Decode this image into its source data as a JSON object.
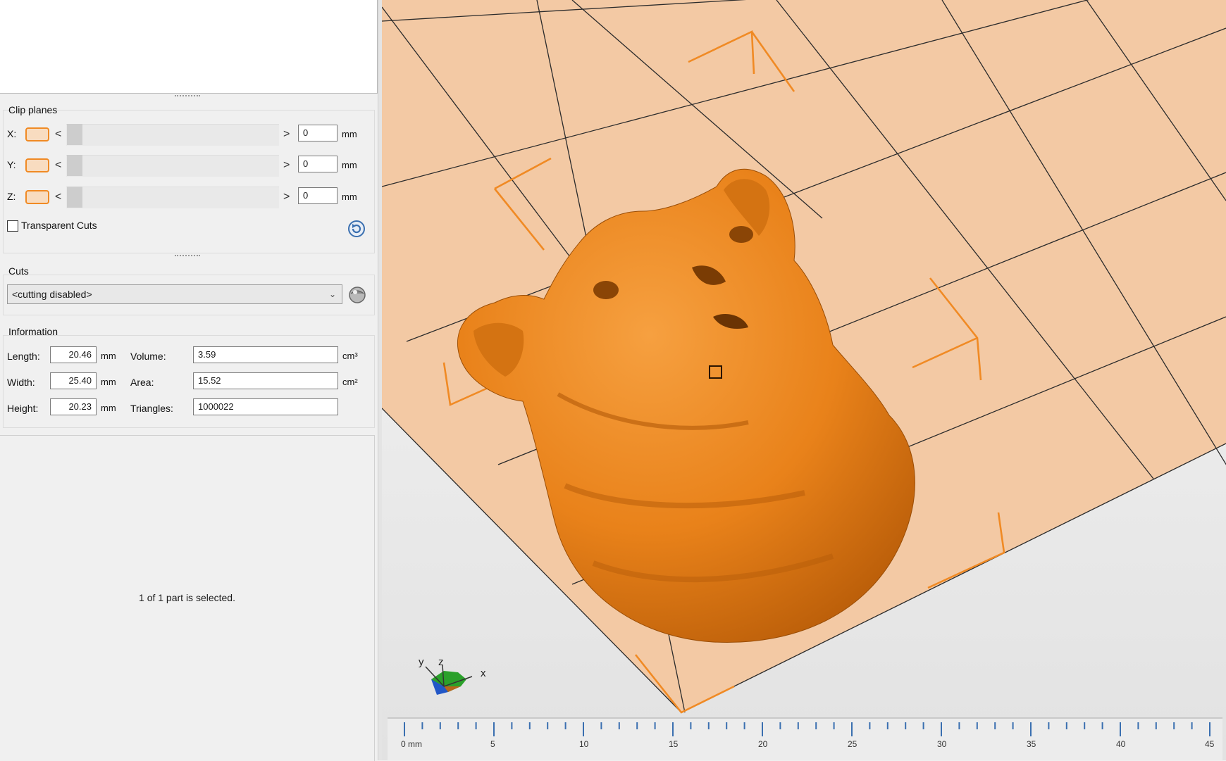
{
  "clip_planes": {
    "title": "Clip planes",
    "rows": [
      {
        "axis": "X:",
        "value": "0",
        "unit": "mm"
      },
      {
        "axis": "Y:",
        "value": "0",
        "unit": "mm"
      },
      {
        "axis": "Z:",
        "value": "0",
        "unit": "mm"
      }
    ],
    "transparent_cuts_label": "Transparent Cuts",
    "arrow_left": "<",
    "arrow_right": ">"
  },
  "cuts": {
    "title": "Cuts",
    "selected": "<cutting disabled>"
  },
  "information": {
    "title": "Information",
    "length_label": "Length:",
    "length": "20.46",
    "length_unit": "mm",
    "width_label": "Width:",
    "width": "25.40",
    "width_unit": "mm",
    "height_label": "Height:",
    "height": "20.23",
    "height_unit": "mm",
    "volume_label": "Volume:",
    "volume": "3.59",
    "volume_unit": "cm³",
    "area_label": "Area:",
    "area": "15.52",
    "area_unit": "cm²",
    "triangles_label": "Triangles:",
    "triangles": "1000022"
  },
  "status": {
    "selection": "1 of 1 part is selected."
  },
  "axis_triad": {
    "x": "x",
    "y": "y",
    "z": "z"
  },
  "ruler": {
    "ticks": [
      "0 mm",
      "5",
      "10",
      "15",
      "20",
      "25",
      "30",
      "35",
      "40",
      "45"
    ]
  },
  "colors": {
    "accent": "#f08a24",
    "plate": "#f3c9a4",
    "model": "#ee8a1c"
  }
}
